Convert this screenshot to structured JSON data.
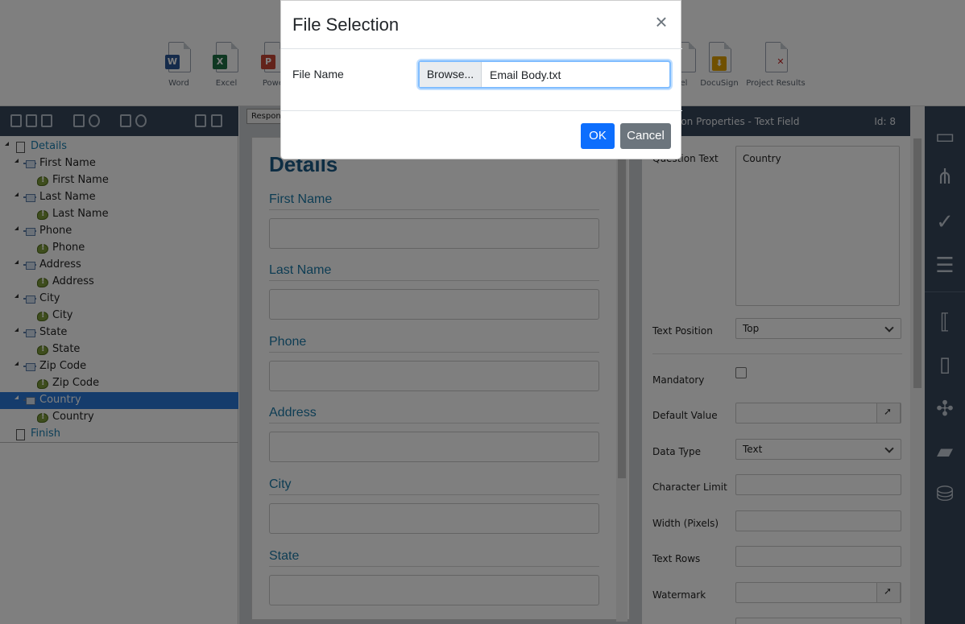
{
  "ribbon": {
    "buttons": [
      {
        "label": "Word",
        "badge": "W",
        "color": "#2b5797"
      },
      {
        "label": "Excel",
        "badge": "X",
        "color": "#1e7145"
      },
      {
        "label": "Power",
        "badge": "P",
        "color": "#c74634"
      },
      {
        "label": "el",
        "badge": "",
        "color": "#c74634"
      },
      {
        "label": "DocuSign",
        "badge": "",
        "color": "#e0a100"
      },
      {
        "label": "Project Results",
        "badge": "",
        "color": "#c02020"
      }
    ]
  },
  "tree": {
    "items": [
      {
        "label": "Details",
        "type": "page"
      },
      {
        "label": "First Name",
        "type": "question"
      },
      {
        "label": "First Name",
        "type": "field"
      },
      {
        "label": "Last Name",
        "type": "question"
      },
      {
        "label": "Last Name",
        "type": "field"
      },
      {
        "label": "Phone",
        "type": "question"
      },
      {
        "label": "Phone",
        "type": "field"
      },
      {
        "label": "Address",
        "type": "question"
      },
      {
        "label": "Address",
        "type": "field"
      },
      {
        "label": "City",
        "type": "question"
      },
      {
        "label": "City",
        "type": "field"
      },
      {
        "label": "State",
        "type": "question"
      },
      {
        "label": "State",
        "type": "field"
      },
      {
        "label": "Zip Code",
        "type": "question"
      },
      {
        "label": "Zip Code",
        "type": "field"
      },
      {
        "label": "Country",
        "type": "question",
        "selected": true
      },
      {
        "label": "Country",
        "type": "field"
      },
      {
        "label": "Finish",
        "type": "page"
      }
    ]
  },
  "center": {
    "tab_label": "Respons",
    "form_title": "Details",
    "fields": [
      "First Name",
      "Last Name",
      "Phone",
      "Address",
      "City",
      "State"
    ]
  },
  "props": {
    "header_title": "ion Properties - Text Field",
    "header_id": "Id: 8",
    "question_text_label": "Question Text",
    "question_text_value": "Country",
    "text_position_label": "Text Position",
    "text_position_value": "Top",
    "mandatory_label": "Mandatory",
    "default_value_label": "Default Value",
    "data_type_label": "Data Type",
    "data_type_value": "Text",
    "char_limit_label": "Character Limit",
    "width_label": "Width (Pixels)",
    "text_rows_label": "Text Rows",
    "watermark_label": "Watermark"
  },
  "modal": {
    "title": "File Selection",
    "close_glyph": "×",
    "file_name_label": "File Name",
    "browse_label": "Browse...",
    "file_value": "Email Body.txt",
    "ok_label": "OK",
    "cancel_label": "Cancel"
  }
}
